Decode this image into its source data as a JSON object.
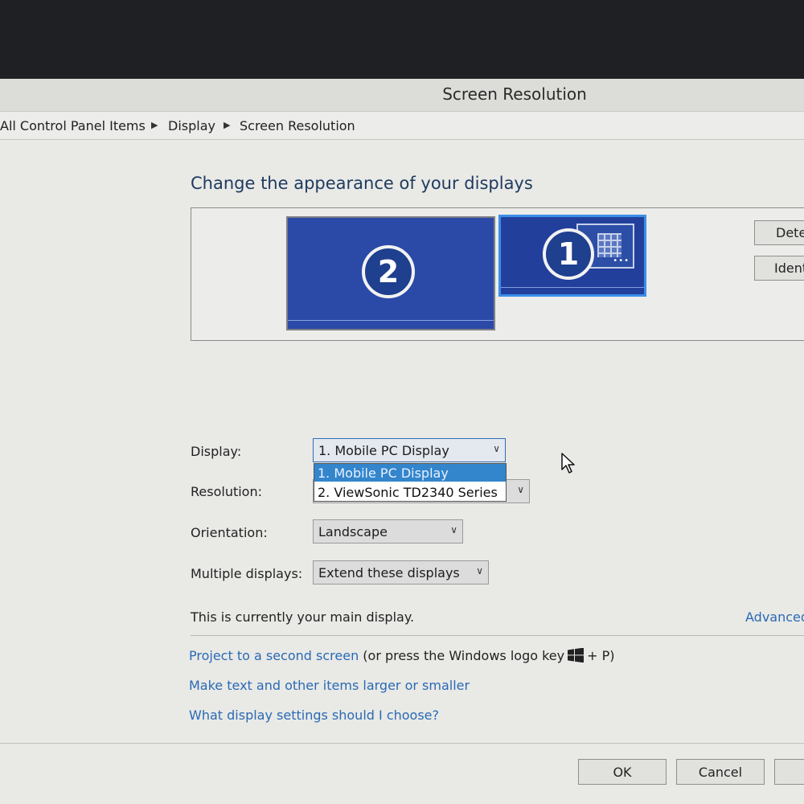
{
  "window": {
    "title": "Screen Resolution"
  },
  "breadcrumb": {
    "items": [
      "All Control Panel Items",
      "Display",
      "Screen Resolution"
    ]
  },
  "heading": "Change the appearance of your displays",
  "preview": {
    "monitors": [
      {
        "number": "2",
        "selected": false
      },
      {
        "number": "1",
        "selected": true
      }
    ],
    "buttons": {
      "detect": "Dete",
      "identify": "Ident"
    }
  },
  "form": {
    "display": {
      "label": "Display:",
      "value": "1. Mobile PC Display",
      "options": [
        "1. Mobile PC Display",
        "2. ViewSonic TD2340 Series"
      ]
    },
    "resolution": {
      "label": "Resolution:"
    },
    "orientation": {
      "label": "Orientation:",
      "value": "Landscape"
    },
    "multiple_displays": {
      "label": "Multiple displays:",
      "value": "Extend these displays"
    }
  },
  "status_message": "This is currently your main display.",
  "advanced_link": "Advanced",
  "links": {
    "project": "Project to a second screen",
    "project_hint_pre": "(or press the Windows logo key",
    "project_hint_post": "+ P)",
    "text_size": "Make text and other items larger or smaller",
    "what_settings": "What display settings should I choose?"
  },
  "footer": {
    "ok": "OK",
    "cancel": "Cancel"
  },
  "colors": {
    "link": "#2a6ab5",
    "monitor_fill": "#2b4aa8",
    "selected_border": "#3a8ee8",
    "dropdown_highlight": "#3385cc"
  }
}
